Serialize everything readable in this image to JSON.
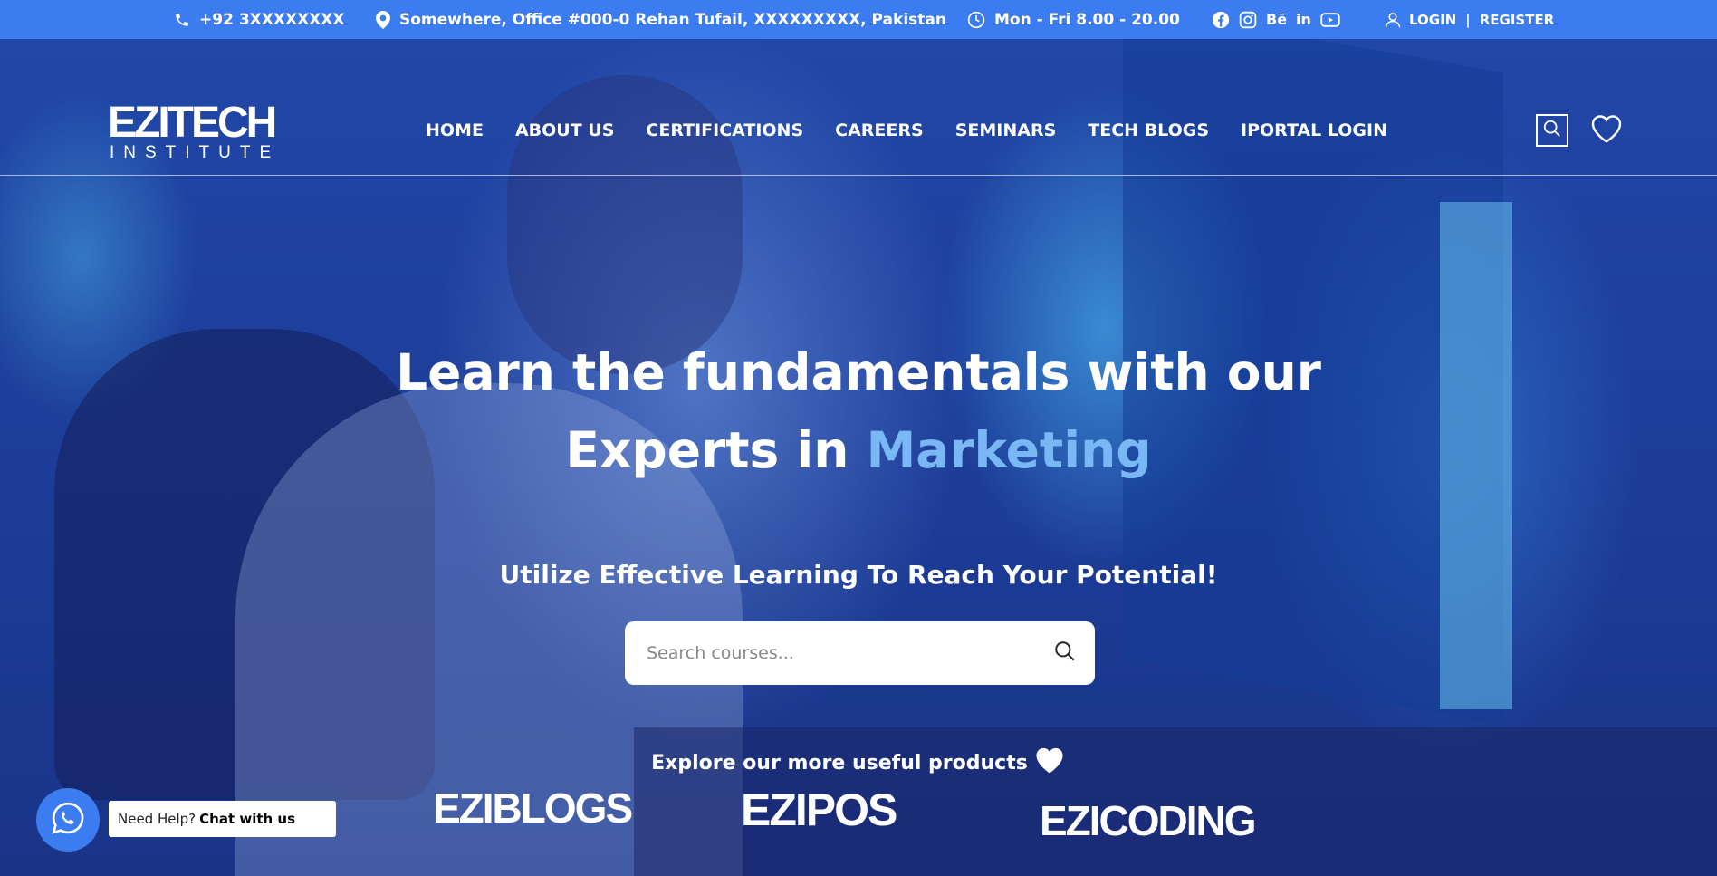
{
  "topbar": {
    "phone": "+92 3XXXXXXXX",
    "address": "Somewhere, Office #000-0 Rehan Tufail, XXXXXXXXX, Pakistan",
    "hours": "Mon - Fri 8.00 - 20.00",
    "socials": [
      "facebook-icon",
      "instagram-icon",
      "behance-icon",
      "linkedin-icon",
      "youtube-icon"
    ],
    "behance_label": "Bē",
    "linkedin_label": "in",
    "login": "LOGIN",
    "register": "REGISTER",
    "separator": "|"
  },
  "header": {
    "logo_main": "EZITECH",
    "logo_sub": "INSTITUTE",
    "nav": [
      "HOME",
      "ABOUT US",
      "CERTIFICATIONS",
      "CAREERS",
      "SEMINARS",
      "TECH BLOGS",
      "IPORTAL LOGIN"
    ]
  },
  "hero": {
    "headline_line1": "Learn the fundamentals with our",
    "headline_line2": "Experts in",
    "headline_accent": "Marketing",
    "tagline": "Utilize Effective Learning To Reach Your Potential!",
    "search_placeholder": "Search courses...",
    "explore": "Explore our more useful products"
  },
  "products": [
    "EZIBLOGS",
    "EZIPOS",
    "EZICODING"
  ],
  "chat": {
    "need_help": "Need Help?",
    "chat_label": "Chat with us"
  },
  "colors": {
    "topbar": "#3b7cf0",
    "accent": "#7ab8f5",
    "hero_overlay": "#1d3e9a"
  }
}
